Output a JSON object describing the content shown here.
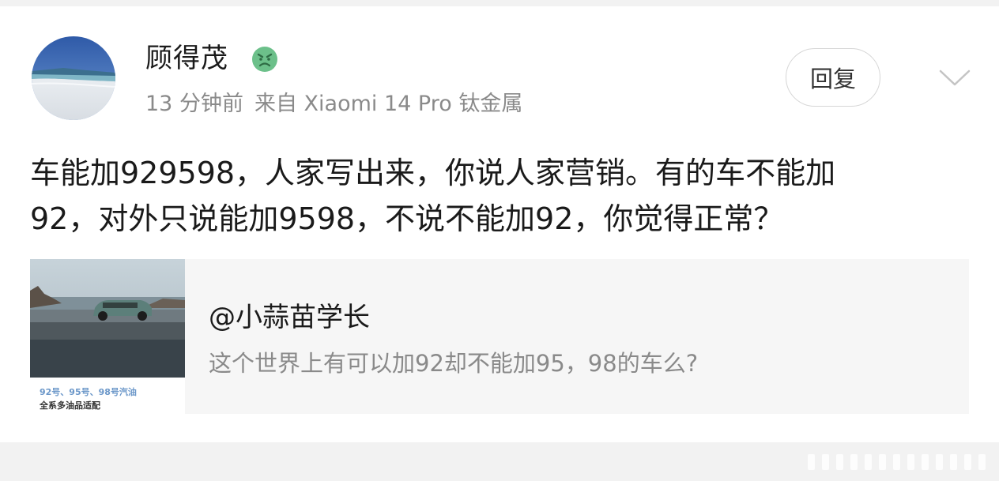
{
  "post": {
    "author_name": "顾得茂",
    "time": "13 分钟前",
    "source": "来自 Xiaomi 14 Pro 钛金属",
    "reply_label": "回复",
    "content_lines": [
      "车能加929598，人家写出来，你说人家营销。有的车不能加",
      "92，对外只说能加9598，不说不能加92，你觉得正常？"
    ]
  },
  "quote": {
    "author": "@小蒜苗学长",
    "text": "这个世界上有可以加92却不能加95，98的车么?",
    "thumbnail_caption_1": "92号、95号、98号汽油",
    "thumbnail_caption_2": "全系多油品适配"
  },
  "icons": {
    "badge": "angry-face-emoji-icon",
    "expand": "chevron-down-icon"
  },
  "colors": {
    "text_primary": "#1a1a1a",
    "text_secondary": "#8a8a8a",
    "emoji_green": "#6cc08a",
    "quote_bg": "#f6f6f6"
  }
}
